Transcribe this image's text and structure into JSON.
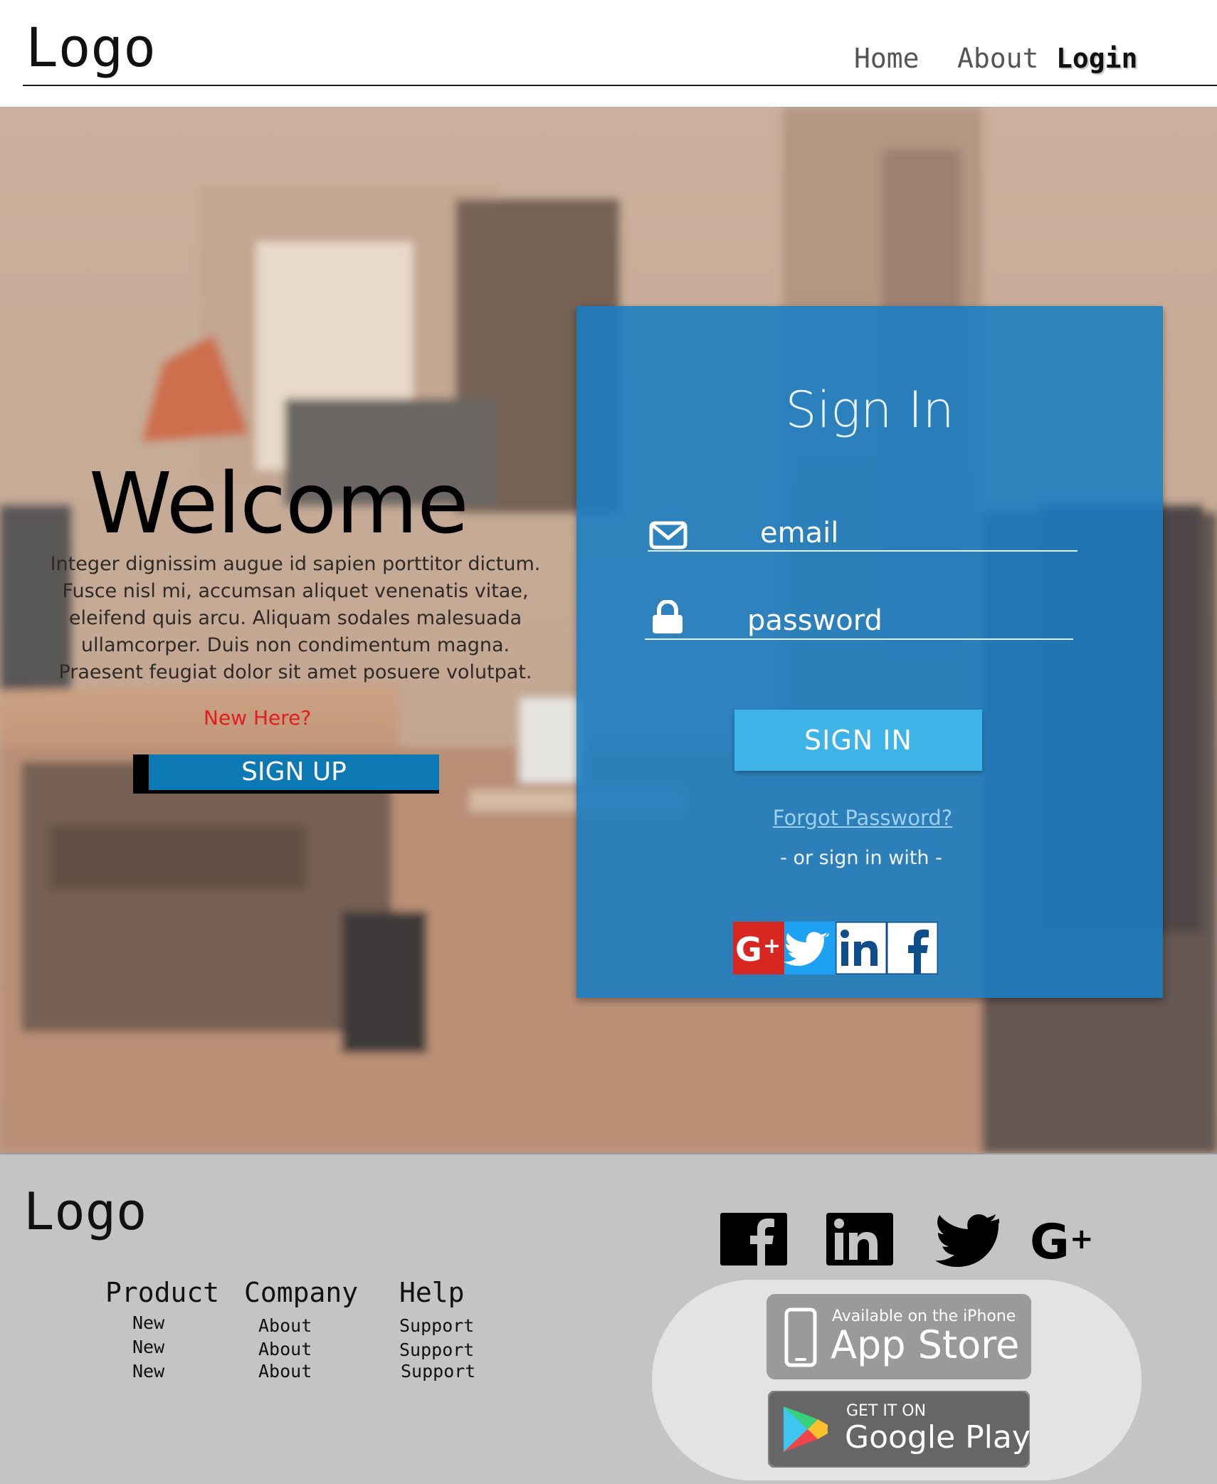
{
  "header": {
    "logo": "Logo",
    "nav": [
      {
        "label": "Home"
      },
      {
        "label": "About"
      },
      {
        "label": "Login"
      }
    ]
  },
  "hero": {
    "welcome": "Welcome",
    "intro_lines": [
      "Integer dignissim augue id sapien porttitor dictum.",
      "Fusce nisl mi, accumsan aliquet venenatis vitae,",
      "eleifend quis arcu. Aliquam sodales malesuada",
      "ullamcorper. Duis non condimentum magna.",
      "Praesent feugiat dolor sit amet posuere volutpat."
    ],
    "new_here": "New Here?",
    "signup_label": "SIGN UP"
  },
  "signin": {
    "title": "Sign In",
    "email_placeholder": "email",
    "password_placeholder": "password",
    "button_label": "SIGN IN",
    "forgot_label": "Forgot Password?",
    "or_label": "- or sign in with -",
    "social": [
      "google-plus",
      "twitter",
      "linkedin",
      "facebook"
    ]
  },
  "footer": {
    "logo": "Logo",
    "columns": [
      {
        "heading": "Product",
        "items": [
          "New",
          "New",
          "New"
        ]
      },
      {
        "heading": "Company",
        "items": [
          "About",
          "About",
          "About"
        ]
      },
      {
        "heading": "Help",
        "items": [
          "Support",
          "Support",
          "Support"
        ]
      }
    ],
    "social": [
      "facebook",
      "linkedin",
      "twitter",
      "google-plus"
    ],
    "app_store": {
      "small": "Available on the iPhone",
      "big": "App Store"
    },
    "google_play": {
      "small": "GET IT ON",
      "big": "Google Play"
    }
  },
  "colors": {
    "panel": "#197dc3",
    "signin_button": "#3db3e8",
    "signup_button": "#0c78b4",
    "new_here": "#e21d1d",
    "footer_bg": "#c4c4c4"
  }
}
